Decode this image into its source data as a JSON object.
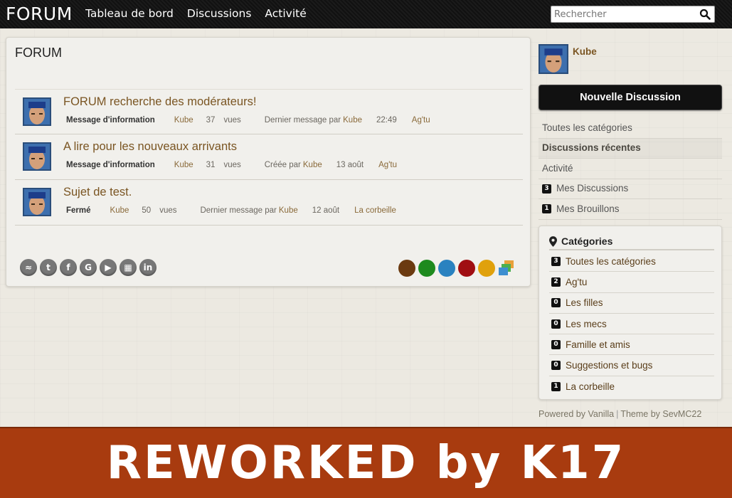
{
  "header": {
    "brand": "FORUM",
    "nav": [
      "Tableau de bord",
      "Discussions",
      "Activité"
    ],
    "search_placeholder": "Rechercher"
  },
  "main": {
    "title": "FORUM",
    "discussions": [
      {
        "title": "FORUM recherche des modérateurs!",
        "tag": "Message d'information",
        "author": "Kube",
        "views": "37",
        "views_label": "vues",
        "last_label": "Dernier message par",
        "last_user": "Kube",
        "time": "22:49",
        "category": "Ag'tu"
      },
      {
        "title": "A lire pour les nouveaux arrivants",
        "tag": "Message d'information",
        "author": "Kube",
        "views": "31",
        "views_label": "vues",
        "last_label": "Créée par",
        "last_user": "Kube",
        "time": "13 août",
        "category": "Ag'tu"
      },
      {
        "title": "Sujet de test.",
        "tag": "Fermé",
        "author": "Kube",
        "views": "50",
        "views_label": "vues",
        "last_label": "Dernier message par",
        "last_user": "Kube",
        "time": "12 août",
        "category": "La corbeille"
      }
    ],
    "social_icons": [
      "rss-icon",
      "twitter-icon",
      "facebook-icon",
      "google-icon",
      "youtube-icon",
      "delicious-icon",
      "linkedin-icon"
    ],
    "theme_colors": [
      "#6b3a10",
      "#1e8a1e",
      "#2a82c0",
      "#a00e12",
      "#e0a10c"
    ]
  },
  "sidebar": {
    "user": {
      "name": "Kube",
      "icons": [
        "globe-icon",
        "mail-icon",
        "star-icon",
        "gear-icon"
      ]
    },
    "new_discussion": "Nouvelle Discussion",
    "nav": [
      {
        "label": "Toutes les catégories",
        "count": ""
      },
      {
        "label": "Discussions récentes",
        "count": ""
      },
      {
        "label": "Activité",
        "count": ""
      },
      {
        "label": "Mes Discussions",
        "count": "3"
      },
      {
        "label": "Mes Brouillons",
        "count": "1"
      }
    ],
    "categories_title": "Catégories",
    "categories": [
      {
        "label": "Toutes les catégories",
        "count": "3"
      },
      {
        "label": "Ag'tu",
        "count": "2"
      },
      {
        "label": "Les filles",
        "count": "0"
      },
      {
        "label": "Les mecs",
        "count": "0"
      },
      {
        "label": "Famille et amis",
        "count": "0"
      },
      {
        "label": "Suggestions et bugs",
        "count": "0"
      },
      {
        "label": "La corbeille",
        "count": "1"
      }
    ],
    "footer": {
      "powered": "Powered by Vanilla",
      "sep": "|",
      "theme": "Theme by SevMC22"
    }
  },
  "banner": {
    "text": "REWORKED by K17"
  },
  "colors": {
    "accent_brown": "#7a5522",
    "banner_bg": "#a83b0f",
    "topbar_bg": "#141414"
  }
}
